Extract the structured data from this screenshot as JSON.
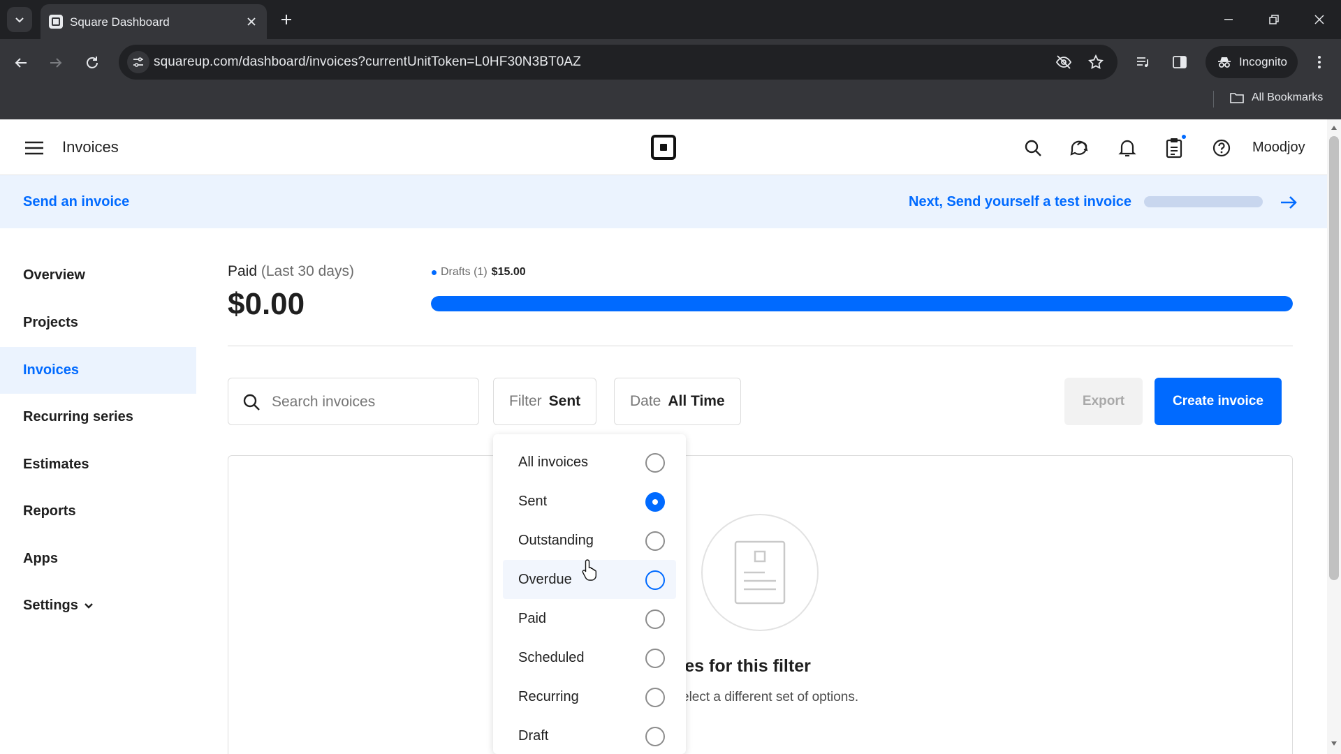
{
  "browser": {
    "tab_title": "Square Dashboard",
    "url": "squareup.com/dashboard/invoices?currentUnitToken=L0HF30N3BT0AZ",
    "incognito_label": "Incognito",
    "bookmarks_label": "All Bookmarks"
  },
  "header": {
    "page_title": "Invoices",
    "account_name": "Moodjoy"
  },
  "banner": {
    "left_link": "Send an invoice",
    "right_link": "Next, Send yourself a test invoice",
    "progress_fraction": 0.0
  },
  "sidebar": {
    "items": [
      {
        "label": "Overview"
      },
      {
        "label": "Projects"
      },
      {
        "label": "Invoices"
      },
      {
        "label": "Recurring series"
      },
      {
        "label": "Estimates"
      },
      {
        "label": "Reports"
      },
      {
        "label": "Apps"
      },
      {
        "label": "Settings"
      }
    ],
    "active_index": 2
  },
  "summary": {
    "paid_label": "Paid",
    "period": "(Last 30 days)",
    "paid_amount": "$0.00",
    "drafts_label": "Drafts (1)",
    "drafts_amount": "$15.00",
    "drafts_bar_fraction": 1.0
  },
  "toolbar": {
    "search_placeholder": "Search invoices",
    "filter_key": "Filter",
    "filter_value": "Sent",
    "date_key": "Date",
    "date_value": "All Time",
    "export_label": "Export",
    "create_label": "Create invoice"
  },
  "filter_dropdown": {
    "options": [
      {
        "label": "All invoices",
        "selected": false
      },
      {
        "label": "Sent",
        "selected": true
      },
      {
        "label": "Outstanding",
        "selected": false
      },
      {
        "label": "Overdue",
        "selected": false
      },
      {
        "label": "Paid",
        "selected": false
      },
      {
        "label": "Scheduled",
        "selected": false
      },
      {
        "label": "Recurring",
        "selected": false
      },
      {
        "label": "Draft",
        "selected": false
      }
    ],
    "hovered_index": 3
  },
  "empty_state": {
    "title": "invoices for this filter",
    "subtitle": "elect a different set of options."
  },
  "colors": {
    "accent": "#006aff",
    "banner_bg": "#ebf3fe"
  }
}
